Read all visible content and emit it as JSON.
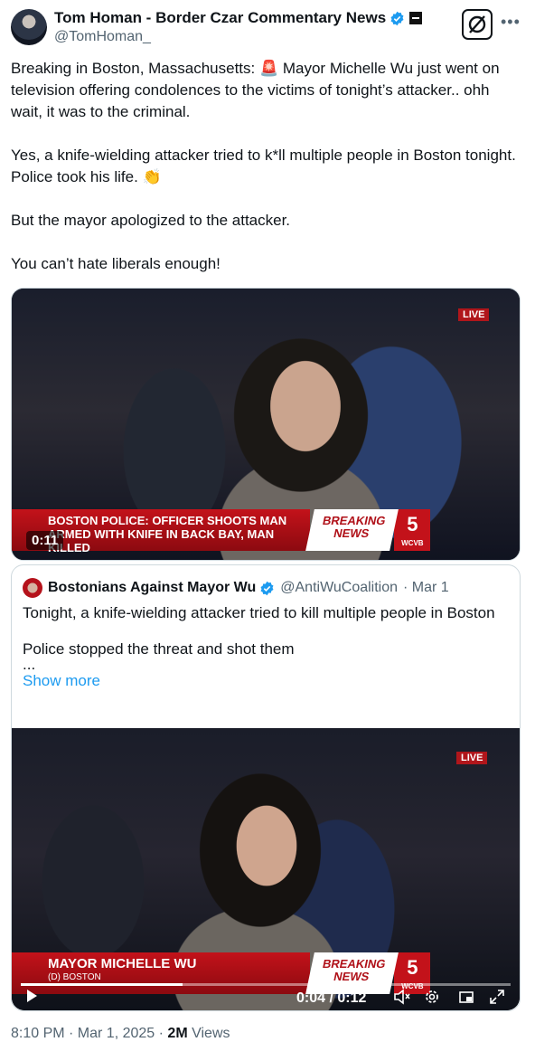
{
  "author": {
    "display_name": "Tom Homan - Border Czar Commentary News",
    "handle": "@TomHoman_"
  },
  "tweet": {
    "paragraphs": [
      "Breaking in Boston, Massachusetts: 🚨 Mayor Michelle Wu just went on television offering condolences to the victims of tonight’s attacker.. ohh wait, it was to the criminal.",
      "Yes, a knife-wielding attacker tried to k*ll multiple people in Boston tonight. Police took his life. 👏",
      "But the mayor apologized to the attacker.",
      "You can’t hate liberals enough!"
    ]
  },
  "video1": {
    "live_label": "LIVE",
    "chyron_line1": "BOSTON POLICE: OFFICER SHOOTS MAN",
    "chyron_line2": "ARMED WITH KNIFE IN BACK BAY, MAN KILLED",
    "breaking_line1": "BREAKING",
    "breaking_line2": "NEWS",
    "station_logo": "5",
    "station": "WCVB",
    "timestamp": "0:11"
  },
  "quote": {
    "display_name": "Bostonians Against Mayor Wu",
    "handle": "@AntiWuCoalition",
    "date": "· Mar 1",
    "text_line1": "Tonight, a knife-wielding attacker tried to kill multiple people in Boston",
    "text_line2": "Police stopped the threat and shot them",
    "ellipsis": "...",
    "show_more": "Show more"
  },
  "video2": {
    "live_label": "LIVE",
    "chyron_name": "MAYOR MICHELLE WU",
    "chyron_sub": "(D) BOSTON",
    "breaking_line1": "BREAKING",
    "breaking_line2": "NEWS",
    "station_logo": "5",
    "station": "WCVB",
    "time_display": "0:04 / 0:12",
    "progress_fraction": 0.33
  },
  "footer": {
    "time_date": "8:10 PM · Mar 1, 2025 ·",
    "views_count": "2M",
    "views_label": "Views"
  },
  "colors": {
    "link": "#1d9bf0",
    "verified": "#1d9bf0",
    "news_red": "#c3121a"
  },
  "icons": [
    "verified-icon",
    "government-badge-icon",
    "grok-icon",
    "more-icon",
    "play-icon",
    "mute-icon",
    "settings-icon",
    "pip-icon",
    "fullscreen-icon"
  ]
}
